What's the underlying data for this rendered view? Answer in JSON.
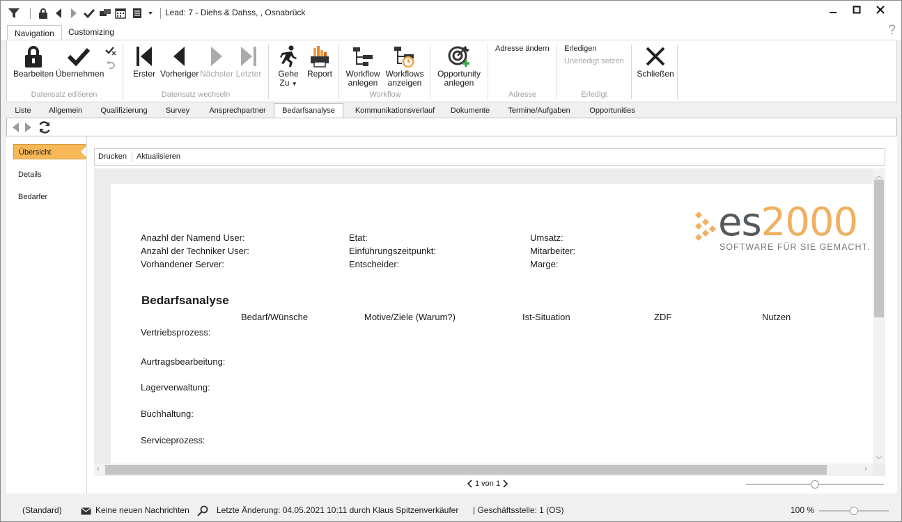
{
  "window": {
    "title": "Lead: 7 - Diehs & Dahss, , Osnabrück"
  },
  "ribbon_tabs": [
    "Navigation",
    "Customizing"
  ],
  "ribbon": {
    "bearbeiten": "Bearbeiten",
    "uebernehmen": "Übernehmen",
    "group_datensatz_editieren": "Datensatz editieren",
    "erster": "Erster",
    "vorheriger": "Vorheriger",
    "naechster": "Nächster",
    "letzter": "Letzter",
    "group_datensatz_wechseln": "Datensatz wechseln",
    "gehe_zu_line1": "Gehe",
    "gehe_zu_line2": "Zu",
    "report": "Report",
    "workflow_anlegen_line1": "Workflow",
    "workflow_anlegen_line2": "anlegen",
    "workflows_anzeigen_line1": "Workflows",
    "workflows_anzeigen_line2": "anzeigen",
    "group_workflow": "Workflow",
    "opportunity_line1": "Opportunity",
    "opportunity_line2": "anlegen",
    "adresse_aendern": "Adresse ändern",
    "group_adresse": "Adresse",
    "erledigen": "Erledigen",
    "unerledigt_setzen": "Unerledigt setzen",
    "group_erledigt": "Erledigt",
    "schliessen": "Schließen"
  },
  "page_tabs": [
    "Liste",
    "Allgemein",
    "Qualifizierung",
    "Survey",
    "Ansprechpartner",
    "Bedarfsanalyse",
    "Kommunikationsverlauf",
    "Dokumente",
    "Termine/Aufgaben",
    "Opportunities"
  ],
  "active_page_tab": "Bedarfsanalyse",
  "left_nav": [
    "Übersicht",
    "Details",
    "Bedarfer"
  ],
  "report_toolbar": {
    "drucken": "Drucken",
    "aktualisieren": "Aktualisieren"
  },
  "report": {
    "logo_text": "es2000",
    "logo_tagline": "SOFTWARE FÜR SIE GEMACHT.",
    "fields_col1": [
      "Anazhl der Namend User:",
      "Anzahl der Techniker User:",
      "Vorhandener Server:"
    ],
    "fields_col2": [
      "Etat:",
      "Einführungszeitpunkt:",
      "Entscheider:"
    ],
    "fields_col3": [
      "Umsatz:",
      "Mitarbeiter:",
      "Marge:"
    ],
    "heading": "Bedarfsanalyse",
    "columns": [
      "Bedarf/Wünsche",
      "Motive/Ziele (Warum?)",
      "Ist-Situation",
      "ZDF",
      "Nutzen"
    ],
    "rows": [
      "Vertriebsprozess:",
      "Aurtragsbearbeitung:",
      "Lagerverwaltung:",
      "Buchhaltung:",
      "Serviceprozess:"
    ]
  },
  "pager": {
    "text": "1 von 1"
  },
  "zoom_slider_value": 0.5,
  "status": {
    "layout": "(Standard)",
    "messages": "Keine neuen Nachrichten",
    "last_change": "Letzte Änderung: 04.05.2021 10:11 durch Klaus Spitzenverkäufer",
    "branch": "| Geschäftsstelle:  1 (OS)",
    "zoom": "100 %"
  },
  "colors": {
    "accent_orange": "#f8b858",
    "logo_gray": "#55595c",
    "logo_orange": "#f0b060"
  }
}
